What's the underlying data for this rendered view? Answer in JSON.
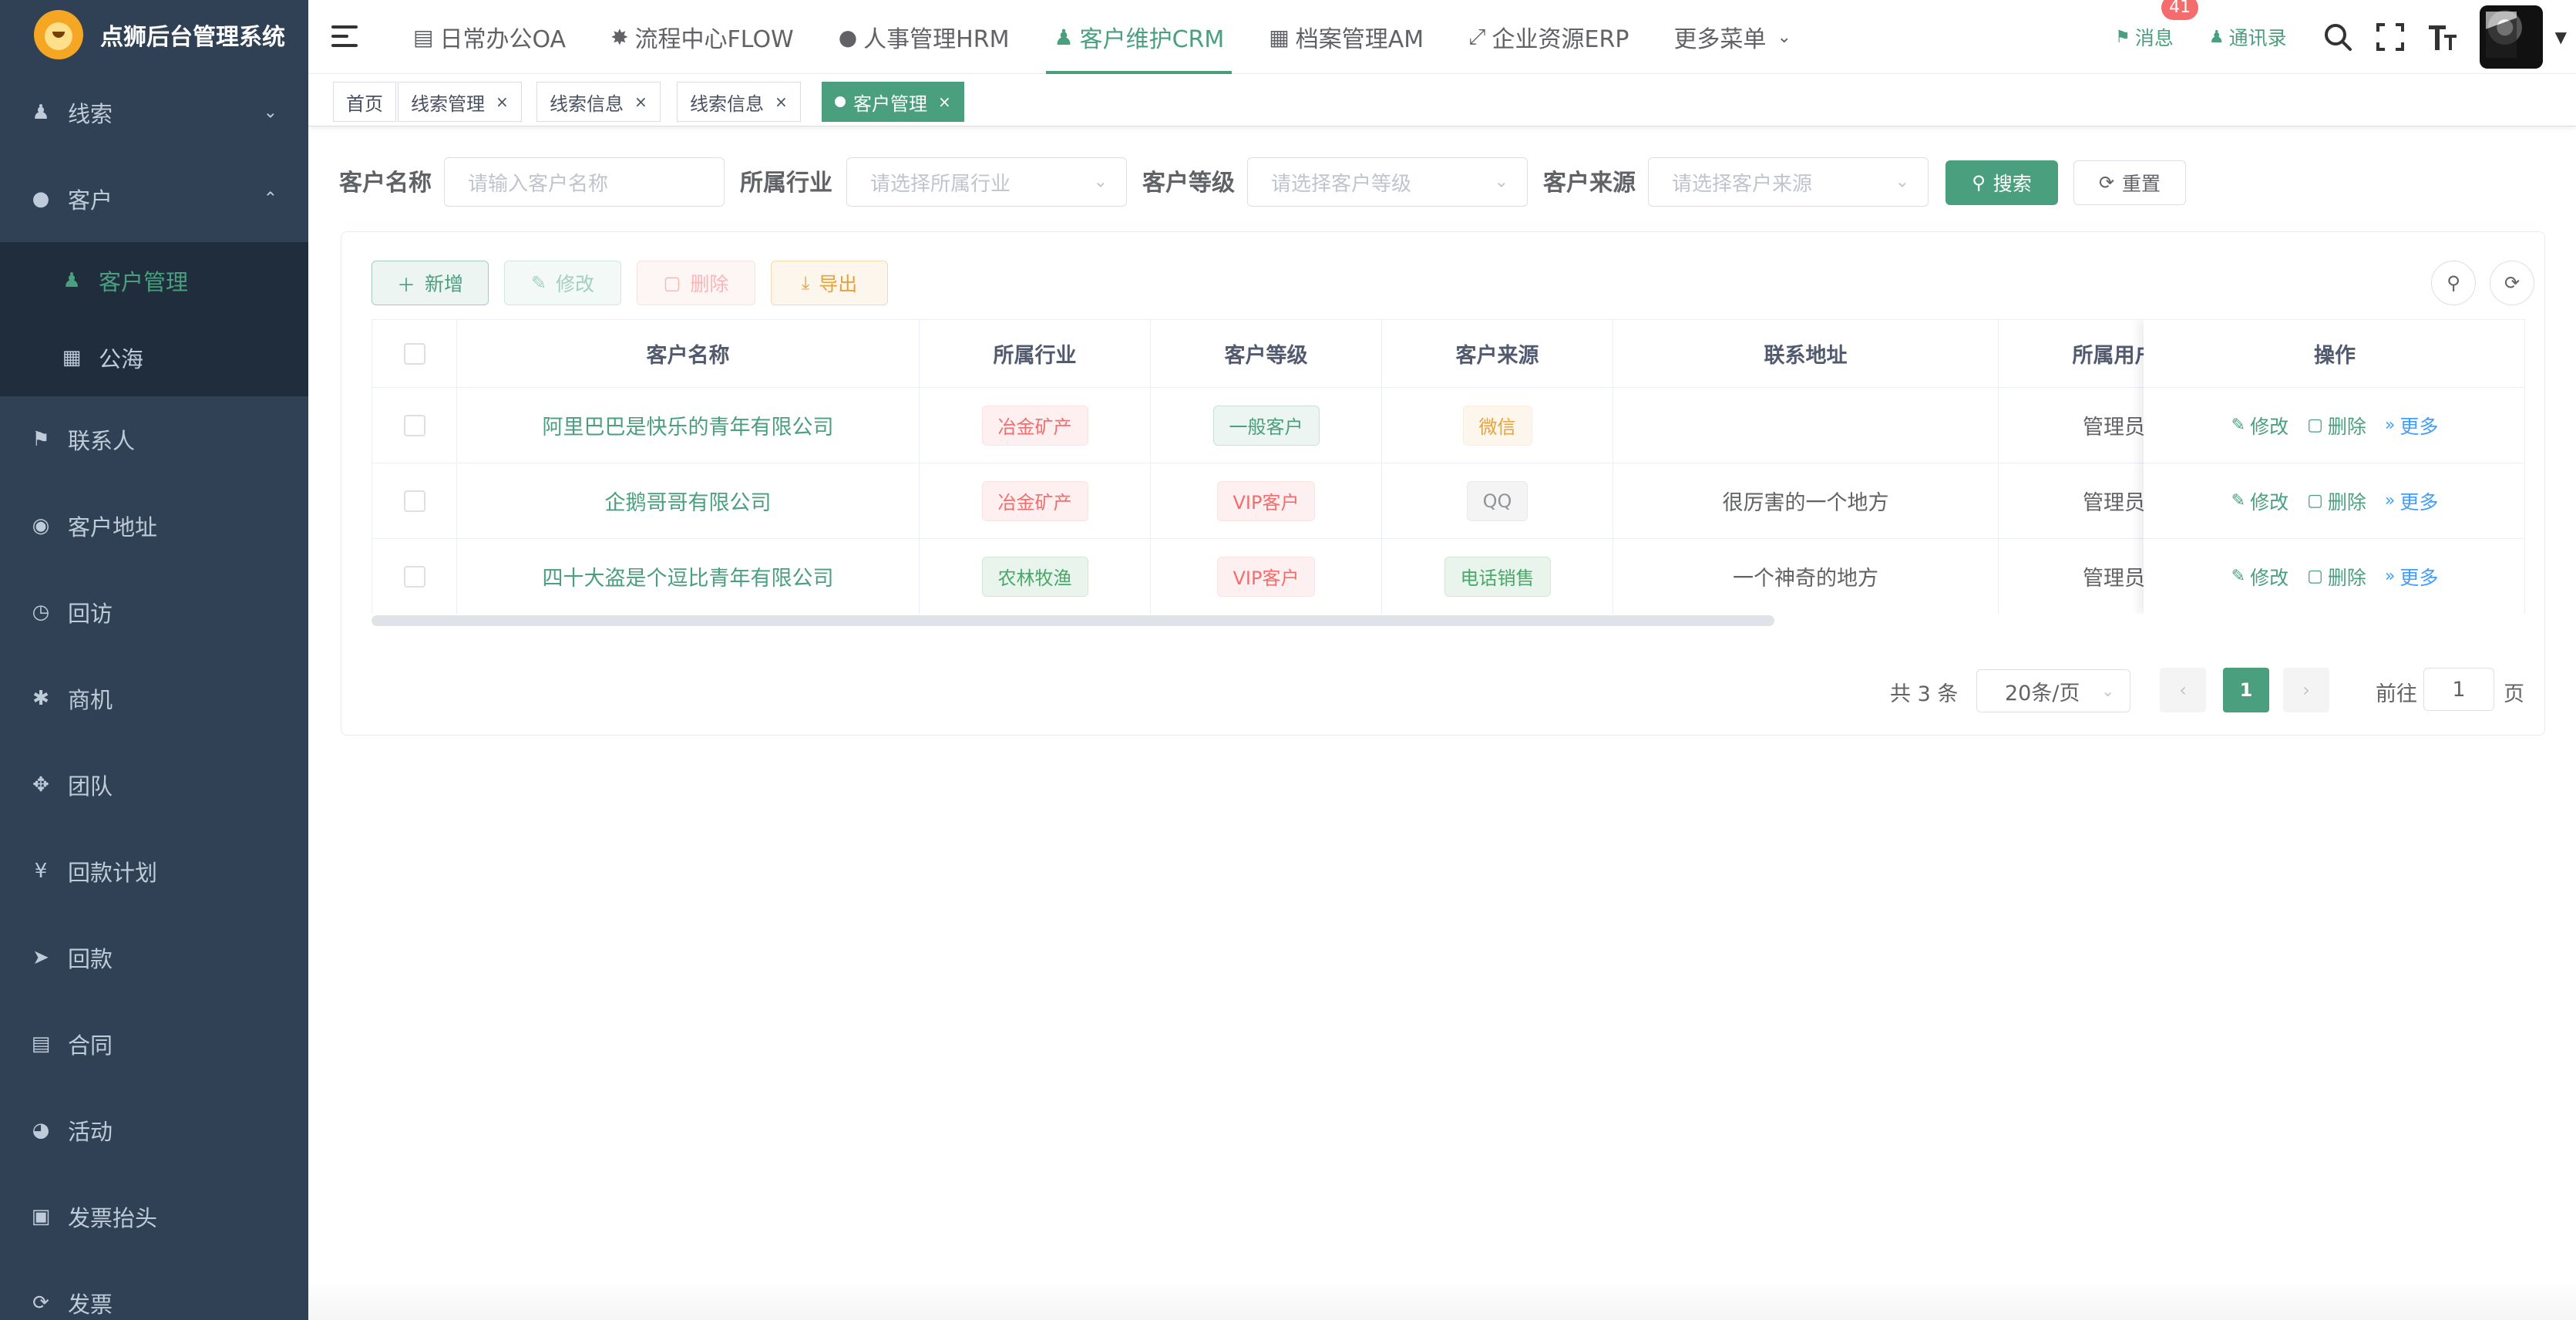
{
  "app": {
    "title": "点狮后台管理系统"
  },
  "sidebar": {
    "groups": [
      {
        "label": "线索",
        "icon": "user-icon",
        "expanded": false
      },
      {
        "label": "客户",
        "icon": "wechat-icon",
        "expanded": true,
        "children": [
          {
            "label": "客户管理",
            "icon": "peoples-icon",
            "active": true
          },
          {
            "label": "公海",
            "icon": "table-icon",
            "active": false
          }
        ]
      },
      {
        "label": "联系人",
        "icon": "bell-icon"
      },
      {
        "label": "客户地址",
        "icon": "globe-icon"
      },
      {
        "label": "回访",
        "icon": "clock-icon"
      },
      {
        "label": "商机",
        "icon": "bug-icon"
      },
      {
        "label": "团队",
        "icon": "move-icon"
      },
      {
        "label": "回款计划",
        "icon": "yen-icon"
      },
      {
        "label": "回款",
        "icon": "send-icon"
      },
      {
        "label": "合同",
        "icon": "file-icon"
      },
      {
        "label": "活动",
        "icon": "dashboard-icon"
      },
      {
        "label": "发票抬头",
        "icon": "image-icon"
      },
      {
        "label": "发票",
        "icon": "refresh-icon"
      }
    ]
  },
  "topnav": {
    "items": [
      {
        "label": "日常办公OA",
        "icon": "document-icon"
      },
      {
        "label": "流程中心FLOW",
        "icon": "workflow-icon"
      },
      {
        "label": "人事管理HRM",
        "icon": "wechat-icon"
      },
      {
        "label": "客户维护CRM",
        "icon": "peoples-icon",
        "active": true
      },
      {
        "label": "档案管理AM",
        "icon": "book-icon"
      },
      {
        "label": "企业资源ERP",
        "icon": "shrink-icon"
      },
      {
        "label": "更多菜单",
        "icon": "chevron-down-icon"
      }
    ],
    "messages": {
      "label": "消息",
      "count": "41"
    },
    "contacts": {
      "label": "通讯录"
    }
  },
  "tags": [
    {
      "label": "首页",
      "closable": false
    },
    {
      "label": "线索管理",
      "closable": true
    },
    {
      "label": "线索信息",
      "closable": true
    },
    {
      "label": "线索信息",
      "closable": true
    },
    {
      "label": "客户管理",
      "closable": true,
      "active": true
    }
  ],
  "search": {
    "customer_name": {
      "label": "客户名称",
      "placeholder": "请输入客户名称"
    },
    "industry": {
      "label": "所属行业",
      "placeholder": "请选择所属行业"
    },
    "level": {
      "label": "客户等级",
      "placeholder": "请选择客户等级"
    },
    "source": {
      "label": "客户来源",
      "placeholder": "请选择客户来源"
    },
    "search_label": "搜索",
    "reset_label": "重置"
  },
  "toolbar": {
    "add_label": "新增",
    "edit_label": "修改",
    "delete_label": "删除",
    "export_label": "导出"
  },
  "table": {
    "columns": [
      "客户名称",
      "所属行业",
      "客户等级",
      "客户来源",
      "联系地址",
      "所属用户",
      "操作"
    ],
    "rows": [
      {
        "name": "阿里巴巴是快乐的青年有限公司",
        "industry": {
          "text": "冶金矿产",
          "type": "danger"
        },
        "level": {
          "text": "一般客户",
          "type": "primary"
        },
        "source": {
          "text": "微信",
          "type": "warning"
        },
        "address": "",
        "owner": "管理员"
      },
      {
        "name": "企鹅哥哥有限公司",
        "industry": {
          "text": "冶金矿产",
          "type": "danger"
        },
        "level": {
          "text": "VIP客户",
          "type": "danger"
        },
        "source": {
          "text": "QQ",
          "type": "info"
        },
        "address": "很厉害的一个地方",
        "owner": "管理员"
      },
      {
        "name": "四十大盗是个逗比青年有限公司",
        "industry": {
          "text": "农林牧渔",
          "type": "success"
        },
        "level": {
          "text": "VIP客户",
          "type": "danger"
        },
        "source": {
          "text": "电话销售",
          "type": "success"
        },
        "address": "一个神奇的地方",
        "owner": "管理员"
      }
    ],
    "actions": {
      "edit": "修改",
      "delete": "删除",
      "more": "更多"
    }
  },
  "pagination": {
    "total_text": "共 3 条",
    "page_size": "20条/页",
    "current": "1",
    "goto_label": "前往",
    "goto_value": "1",
    "goto_unit": "页"
  },
  "colors": {
    "sidebar_bg": "#304156",
    "submenu_bg": "#1f2d3d",
    "accent": "#4a9f7e",
    "danger": "#f56c6c",
    "warning": "#e6a23c",
    "link": "#409eff"
  }
}
